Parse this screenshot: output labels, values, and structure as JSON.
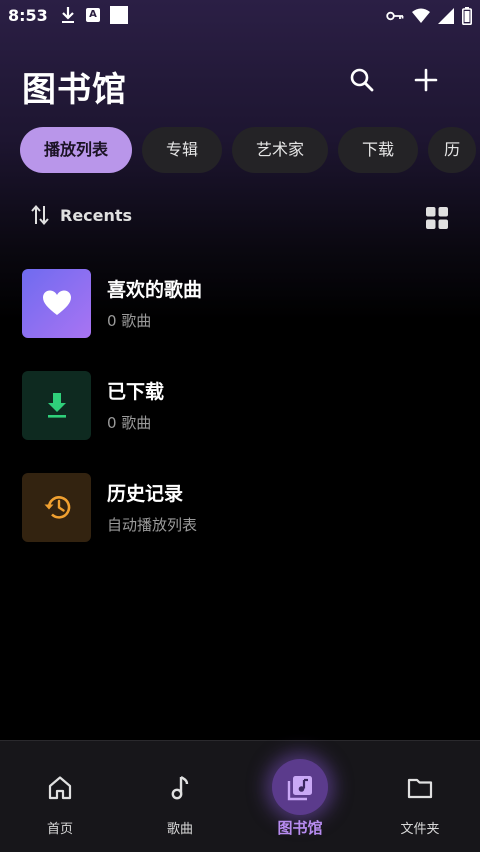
{
  "status_bar": {
    "time": "8:53",
    "left_icons": [
      "download-icon",
      "app-a-icon",
      "white-square-icon"
    ],
    "right_icons": [
      "key-icon",
      "wifi-icon",
      "signal-icon",
      "battery-icon"
    ]
  },
  "header": {
    "title": "图书馆",
    "actions": [
      "search-icon",
      "plus-icon"
    ]
  },
  "chips": [
    {
      "label": "播放列表",
      "active": true
    },
    {
      "label": "专辑",
      "active": false
    },
    {
      "label": "艺术家",
      "active": false
    },
    {
      "label": "下载",
      "active": false
    },
    {
      "label": "历",
      "active": false
    }
  ],
  "sort": {
    "label": "Recents",
    "icon": "sort-arrows-icon",
    "view_icon": "grid-view-icon"
  },
  "items": [
    {
      "title": "喜欢的歌曲",
      "subtitle": "0 歌曲",
      "icon": "heart-icon",
      "color": "#8c70f0"
    },
    {
      "title": "已下载",
      "subtitle": "0 歌曲",
      "icon": "download-icon",
      "color": "#2fd07a"
    },
    {
      "title": "历史记录",
      "subtitle": "自动播放列表",
      "icon": "history-icon",
      "color": "#f0a030"
    }
  ],
  "nav": [
    {
      "label": "首页",
      "icon": "home-icon",
      "active": false
    },
    {
      "label": "歌曲",
      "icon": "music-note-icon",
      "active": false
    },
    {
      "label": "图书馆",
      "icon": "library-music-icon",
      "active": true
    },
    {
      "label": "文件夹",
      "icon": "folder-icon",
      "active": false
    }
  ],
  "colors": {
    "accent": "#b996ea",
    "background": "#000000",
    "chip": "#242326",
    "nav_active": "#b78cf0"
  }
}
